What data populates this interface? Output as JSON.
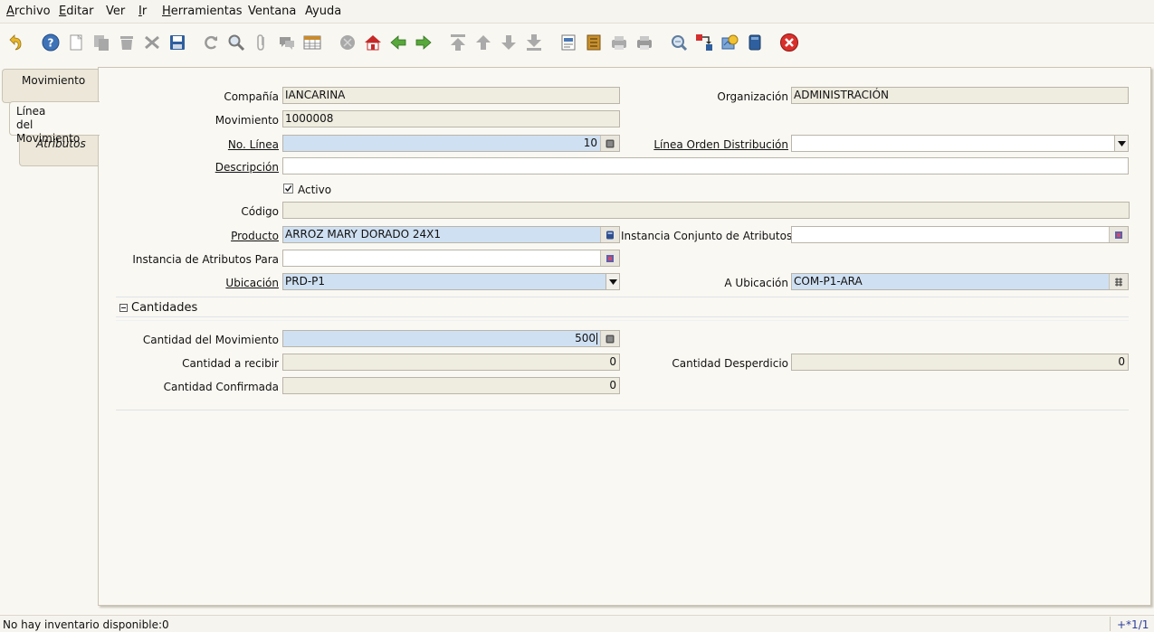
{
  "menu": {
    "archivo": {
      "first": "A",
      "rest": "rchivo"
    },
    "editar": {
      "first": "E",
      "rest": "ditar"
    },
    "ver": "Ver",
    "ir": {
      "first": "I",
      "rest": "r"
    },
    "herramientas": {
      "first": "H",
      "rest": "erramientas"
    },
    "ventana": "Ventana",
    "ayuda": "Ayuda"
  },
  "tabs": {
    "movimiento": "Movimiento",
    "linea_1": "Línea",
    "linea_2": "del Movimiento",
    "atributos": "Atributos"
  },
  "form": {
    "compania_label": "Compañía",
    "compania_value": "IANCARINA",
    "organizacion_label": "Organización",
    "organizacion_value": "ADMINISTRACIÓN",
    "movimiento_label": "Movimiento",
    "movimiento_value": "1000008",
    "nolinea_label": "No. Línea",
    "nolinea_value": "10",
    "linea_orden_label": "Línea Orden Distribución",
    "linea_orden_value": "",
    "descripcion_label": "Descripción",
    "descripcion_value": "",
    "activo_label": "Activo",
    "codigo_label": "Código",
    "codigo_value": "",
    "producto_label": "Producto",
    "producto_value": "ARROZ MARY DORADO 24X1",
    "instancia_conjunto_label": "Instancia Conjunto de Atributos",
    "instancia_conjunto_value": "",
    "instancia_para_label": "Instancia de Atributos Para",
    "instancia_para_value": "",
    "ubicacion_label": "Ubicación",
    "ubicacion_value": "PRD-P1",
    "a_ubicacion_label": "A Ubicación",
    "a_ubicacion_value": "COM-P1-ARA",
    "cantidades_header": "Cantidades",
    "cantidad_mov_label": "Cantidad del Movimiento",
    "cantidad_mov_value": "500",
    "cantidad_recibir_label": "Cantidad a recibir",
    "cantidad_recibir_value": "0",
    "cantidad_desperdicio_label": "Cantidad Desperdicio",
    "cantidad_desperdicio_value": "0",
    "cantidad_confirmada_label": "Cantidad Confirmada",
    "cantidad_confirmada_value": "0"
  },
  "status": {
    "message": "No hay inventario disponible:0",
    "record": "+*1/1"
  },
  "colors": {
    "mandatory": "#cfe0f2",
    "readonly": "#efece0",
    "panel": "#faf8f2",
    "close": "#d9302c"
  }
}
